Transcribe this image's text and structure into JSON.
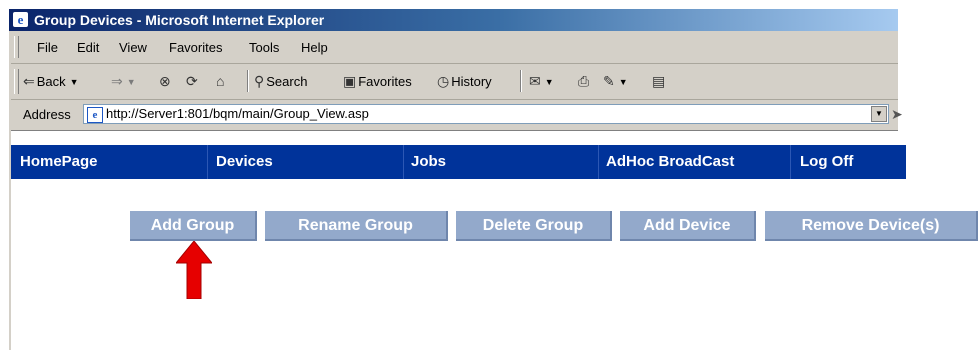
{
  "window": {
    "title": "Group Devices - Microsoft Internet Explorer"
  },
  "menu": [
    "File",
    "Edit",
    "View",
    "Favorites",
    "Tools",
    "Help"
  ],
  "toolbar": {
    "back": "Back",
    "search": "Search",
    "favorites": "Favorites",
    "history": "History"
  },
  "address": {
    "label": "Address",
    "url": "http://Server1:801/bqm/main/Group_View.asp"
  },
  "nav": [
    "HomePage",
    "Devices",
    "Jobs",
    "AdHoc BroadCast",
    "Log Off"
  ],
  "actions": [
    "Add Group",
    "Rename Group",
    "Delete Group",
    "Add Device",
    "Remove Device(s)"
  ],
  "colors": {
    "nav_bg": "#00339a",
    "button_bg": "#93a9cb",
    "arrow": "#e60000"
  }
}
